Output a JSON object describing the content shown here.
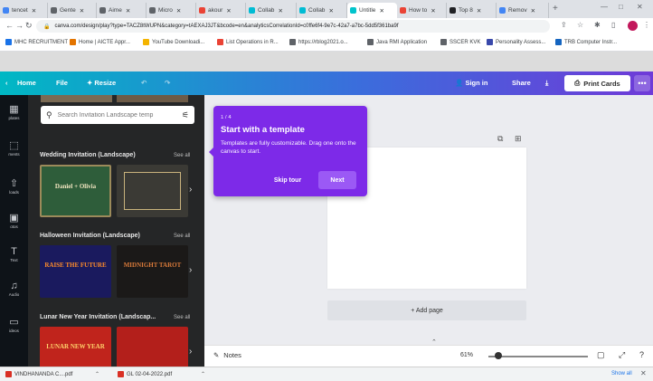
{
  "browser": {
    "tabs": [
      {
        "label": "tencet",
        "color": "#4285f4"
      },
      {
        "label": "Gente",
        "color": "#5f6368"
      },
      {
        "label": "Aime",
        "color": "#5f6368"
      },
      {
        "label": "Micro",
        "color": "#5f6368"
      },
      {
        "label": "akour",
        "color": "#ea4335"
      },
      {
        "label": "Collab",
        "color": "#00bcd4"
      },
      {
        "label": "Collab",
        "color": "#00bcd4"
      },
      {
        "label": "Untitle",
        "color": "#00c4cc"
      },
      {
        "label": "How to",
        "color": "#ea4335"
      },
      {
        "label": "Top 8",
        "color": "#202124"
      },
      {
        "label": "Remov",
        "color": "#4285f4"
      }
    ],
    "new_tab": "+",
    "window_controls": [
      "—",
      "□",
      "✕"
    ],
    "url": "canva.com/design/play?type=TACZ8tWUPN&category=tAEXAJ3JT&bcode=en&analyticsCorrelationId=c0ffe6f4-9e7c-42a7-a7bc-5dd5f361ba9f",
    "bookmarks": [
      {
        "label": "MHC RECRUITMENT",
        "color": "#1a73e8"
      },
      {
        "label": "Home | AICTE Appr...",
        "color": "#e37400"
      },
      {
        "label": "YouTube Downloadi...",
        "color": "#f4b400"
      },
      {
        "label": "List Operations in R...",
        "color": "#ea4335"
      },
      {
        "label": "https://rblog2021.o...",
        "color": "#5f6368"
      },
      {
        "label": "Java RMI Application",
        "color": "#5f6368"
      },
      {
        "label": "SSCER KVK",
        "color": "#5f6368"
      },
      {
        "label": "Personality Assess...",
        "color": "#3949ab"
      },
      {
        "label": "TRB Computer Instr...",
        "color": "#1565c0"
      }
    ]
  },
  "header": {
    "home": "Home",
    "file": "File",
    "resize": "Resize",
    "sign_in": "Sign in",
    "share": "Share",
    "print_cards": "Print Cards",
    "more": "•••"
  },
  "rail": [
    {
      "icon": "▦",
      "label": "plates"
    },
    {
      "icon": "⬚",
      "label": "ments"
    },
    {
      "icon": "⇧",
      "label": "loads"
    },
    {
      "icon": "▣",
      "label": "otos"
    },
    {
      "icon": "T",
      "label": "Text"
    },
    {
      "icon": "♫",
      "label": "Audio"
    },
    {
      "icon": "▭",
      "label": "ideos"
    }
  ],
  "panel": {
    "search_placeholder": "Search Invitation Landscape temp",
    "sections": [
      {
        "title": "Wedding Invitation (Landscape)",
        "see_all": "See all"
      },
      {
        "title": "Halloween Invitation (Landscape)",
        "see_all": "See all"
      },
      {
        "title": "Lunar New Year Invitation (Landscap...",
        "see_all": "See all"
      }
    ],
    "thumbs": [
      {
        "text": "Daniel + Olivia",
        "bg": "#2e5d3a",
        "fg": "#f4e7c2"
      },
      {
        "text": "",
        "bg": "#3b3a35",
        "fg": "#c9b37d"
      },
      {
        "text": "RAISE THE FUTURE",
        "bg": "#1a1a5e",
        "fg": "#ff8c2a"
      },
      {
        "text": "MIDNIGHT TAROT",
        "bg": "#1b1918",
        "fg": "#d97a3a"
      },
      {
        "text": "LUNAR NEW YEAR",
        "bg": "#c0241c",
        "fg": "#ffd36b"
      },
      {
        "text": "",
        "bg": "#b31f1b",
        "fg": "#f5c04a"
      }
    ]
  },
  "tour": {
    "step": "1 / 4",
    "title": "Start with a template",
    "description": "Templates are fully customizable. Drag one onto the canvas to start.",
    "skip": "Skip tour",
    "next": "Next"
  },
  "workspace": {
    "add_page": "+ Add page"
  },
  "bottom": {
    "notes": "Notes",
    "zoom": "61%",
    "zoom_level": 0.61
  },
  "downloads": {
    "items": [
      "VINDHANANDA C....pdf",
      "GL 02-04-2022.pdf"
    ],
    "show_all": "Show all"
  },
  "colors": {
    "purple": "#7d2ae8",
    "teal": "#00c4cc"
  }
}
